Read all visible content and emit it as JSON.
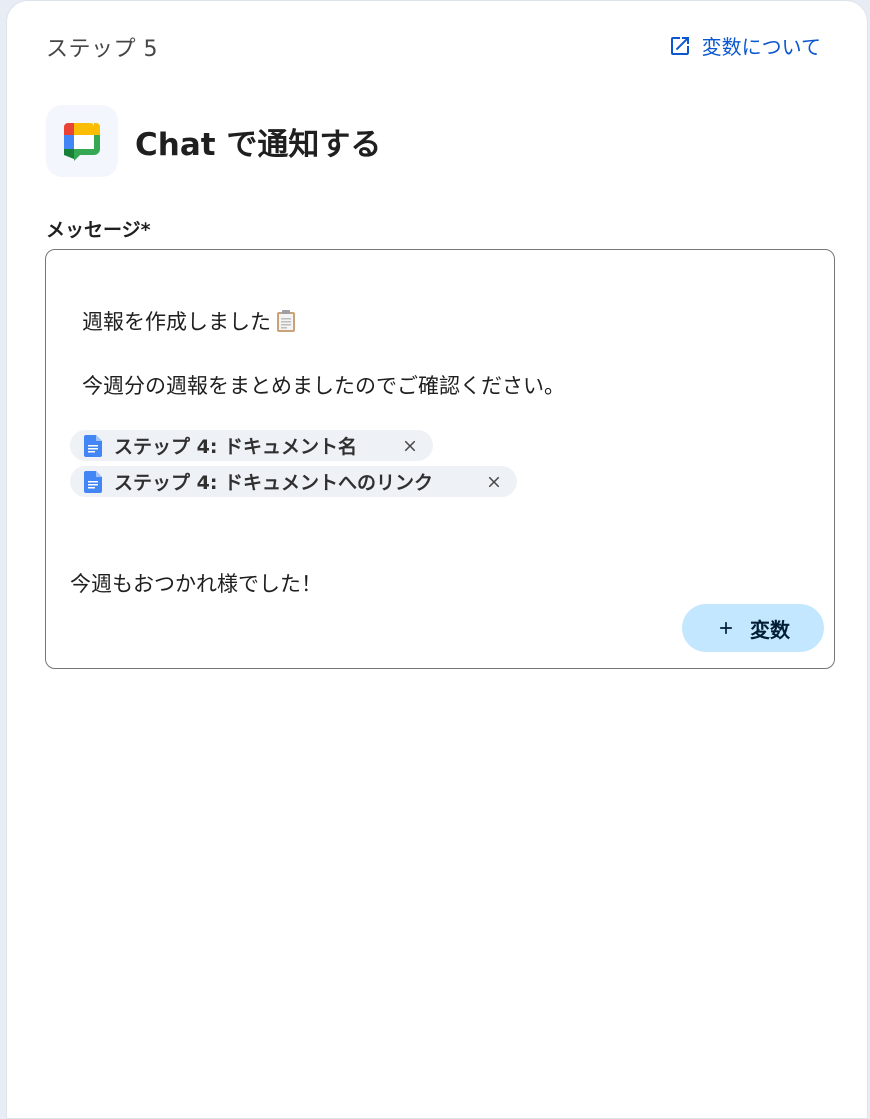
{
  "header": {
    "step_label": "ステップ 5",
    "vars_link_label": "変数について"
  },
  "action": {
    "title": "Chat で通知する",
    "app_icon": "google-chat-icon"
  },
  "message_field": {
    "label": "メッセージ*",
    "line1": "週報を作成しました",
    "line2": "今週分の週報をまとめましたのでご確認ください。",
    "chips": [
      {
        "label": "ステップ 4: ドキュメント名",
        "icon": "google-docs-icon"
      },
      {
        "label": "ステップ 4: ドキュメントへのリンク",
        "icon": "google-docs-icon"
      }
    ],
    "line3": "今週もおつかれ様でした！",
    "add_variable_label": "変数"
  },
  "colors": {
    "link": "#0b57d0",
    "add_button_bg": "#c2e7ff",
    "chip_bg": "#eef1f6",
    "docs_blue": "#4285f4"
  }
}
